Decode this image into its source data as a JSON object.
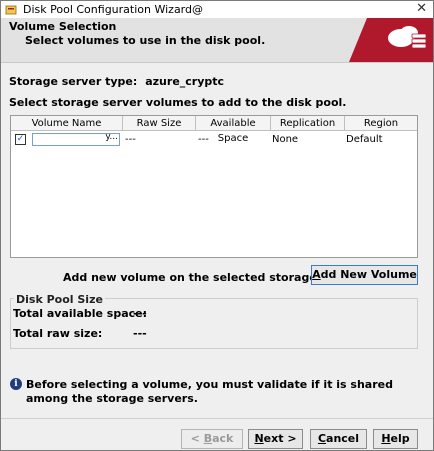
{
  "window": {
    "title": "Disk Pool Configuration Wizard@",
    "close_glyph": "✕"
  },
  "banner": {
    "title": "Volume Selection",
    "subtitle": "Select volumes to use in the disk pool."
  },
  "server": {
    "type_label": "Storage server type:",
    "type_value": "azure_cryptc"
  },
  "instructions": "Select storage server volumes to add to the disk pool.",
  "table": {
    "headers": [
      "Volume Name",
      "Raw Size",
      "Available Space",
      "Replication",
      "Region"
    ],
    "rows": [
      {
        "checked": true,
        "check_glyph": "☑",
        "name": "",
        "name_suffix": "y...",
        "raw_size": "---",
        "available_space": "---",
        "replication": "None",
        "region": "Default"
      }
    ]
  },
  "add_volume": {
    "label": "Add new volume on the selected storage server(s)",
    "button_prefix": "",
    "button_mnemonic": "A",
    "button_rest": "dd New Volume"
  },
  "disk_pool": {
    "legend": "Disk Pool Size",
    "available_label": "Total available space:",
    "available_value": "---",
    "raw_label": "Total raw size:",
    "raw_value": "---"
  },
  "info": {
    "icon": "info-icon",
    "text": "Before selecting a volume, you must validate if it is shared among the storage servers."
  },
  "buttons": {
    "back": {
      "prefix": "< ",
      "mnemonic": "B",
      "rest": "ack"
    },
    "next": {
      "prefix": "",
      "mnemonic": "N",
      "rest": "ext >"
    },
    "cancel": {
      "prefix": "",
      "mnemonic": "C",
      "rest": "ancel"
    },
    "help": {
      "prefix": "",
      "mnemonic": "H",
      "rest": "elp"
    }
  },
  "colors": {
    "accent_red": "#b0182b",
    "selection_blue": "#3a7ad0"
  }
}
